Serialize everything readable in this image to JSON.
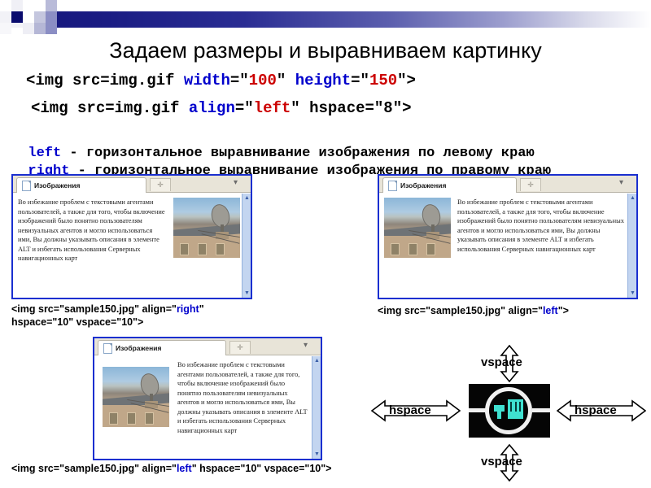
{
  "slide": {
    "title": "Задаем размеры и выравниваем картинку"
  },
  "code_lines": [
    {
      "id": "code-line-1",
      "parts": [
        {
          "text": "<img src=img.gif ",
          "color": "black"
        },
        {
          "text": "width",
          "color": "blue"
        },
        {
          "text": "=\"",
          "color": "black"
        },
        {
          "text": "100",
          "color": "red"
        },
        {
          "text": "\" ",
          "color": "black"
        },
        {
          "text": "height",
          "color": "blue"
        },
        {
          "text": "=\"",
          "color": "black"
        },
        {
          "text": "150",
          "color": "red"
        },
        {
          "text": "\">",
          "color": "black"
        }
      ]
    },
    {
      "id": "code-line-2",
      "parts": [
        {
          "text": "<img src=img.gif ",
          "color": "black"
        },
        {
          "text": "align",
          "color": "blue"
        },
        {
          "text": "=\"",
          "color": "black"
        },
        {
          "text": "left",
          "color": "red"
        },
        {
          "text": "\" hspace=\"8\">",
          "color": "black"
        }
      ]
    }
  ],
  "descriptions": [
    {
      "id": "desc-left",
      "keyword": "left",
      "text": " - горизонтальное выравнивание изображения по левому краю"
    },
    {
      "id": "desc-right",
      "keyword": "right",
      "text": " - горизонтальное выравнивание изображения по правому краю"
    }
  ],
  "browser_windows": [
    {
      "id": "window-align-right",
      "tab_label": "Изображения",
      "newtab_label": "✛",
      "minor_label": "▾",
      "paragraph": "Во избежание проблем с текстовыми агентами пользователей, а также для того, чтобы включение изображений было понятно пользователям невизуальных агентов и могло использоваться ими, Вы должны указывать описания в элементе ALT и избегать использования Серверных навигационных карт",
      "photo_alt": "Спутниковая антенна на крыше дома",
      "scroll_up": "▲",
      "scroll_down": "▼"
    },
    {
      "id": "window-align-left",
      "tab_label": "Изображения",
      "newtab_label": "✛",
      "minor_label": "▾",
      "paragraph": "Во избежание проблем с текстовыми агентами пользователей, а также для того, чтобы включение изображений было понятно пользователям невизуальных агентов и могло использоваться ими, Вы должны указывать описания в элементе ALT и избегать использования Серверных навигационных карт",
      "photo_alt": "Спутниковая антенна на крыше дома",
      "scroll_up": "▲",
      "scroll_down": "▼"
    },
    {
      "id": "window-align-left-spaced",
      "tab_label": "Изображения",
      "newtab_label": "✛",
      "minor_label": "▾",
      "paragraph": "Во избежание проблем с текстовыми агентами пользователей, а также для того, чтобы включение изображений было понятно пользователям невизуальных агентов и могло использоваться ими, Вы должны указывать описания в элементе ALT и избегать использования Серверных навигационных карт",
      "photo_alt": "Спутниковая антенна на крыше дома",
      "scroll_up": "▲",
      "scroll_down": "▼"
    }
  ],
  "captions": [
    {
      "id": "caption-align-right",
      "parts": [
        {
          "text": "<img src=\"sample150.jpg\" align=\"",
          "color": "black"
        },
        {
          "text": "right",
          "color": "blue"
        },
        {
          "text": "\"\nhspace=\"10\" vspace=\"10\">",
          "color": "black"
        }
      ]
    },
    {
      "id": "caption-align-left",
      "parts": [
        {
          "text": "<img src=\"sample150.jpg\" align=\"",
          "color": "black"
        },
        {
          "text": "left",
          "color": "blue"
        },
        {
          "text": "\">",
          "color": "black"
        }
      ]
    },
    {
      "id": "caption-align-left-spaced",
      "parts": [
        {
          "text": "<img src=\"sample150.jpg\" align=\"",
          "color": "black"
        },
        {
          "text": "left",
          "color": "blue"
        },
        {
          "text": "\" hspace=\"10\" vspace=\"10\">",
          "color": "black"
        }
      ]
    }
  ],
  "diagram": {
    "label_vspace_top": "vspace",
    "label_vspace_bottom": "vspace",
    "label_hspace_left": "hspace",
    "label_hspace_right": "hspace",
    "icon_alt": "Тёмная иконка с белым кольцом"
  },
  "colors": {
    "banner_dark": "#16187e",
    "keyword_blue": "#0000cc",
    "value_red": "#cc0000",
    "caption_blue": "#0000dd",
    "window_border": "#1a2fd0",
    "scrollbar": "#c3d5f0",
    "diagram_accent": "#3fe0d0"
  }
}
